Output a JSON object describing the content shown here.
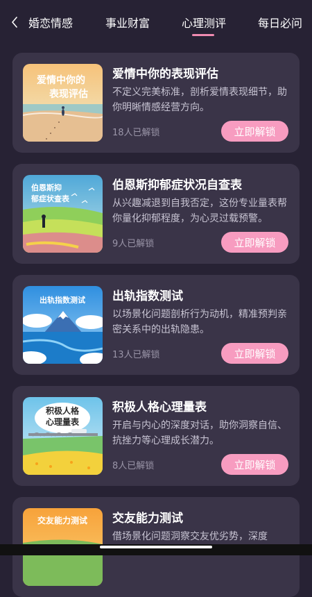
{
  "nav": {
    "back_icon": "chevron-left-icon",
    "tabs": [
      {
        "label": "婚恋情感",
        "active": false
      },
      {
        "label": "事业财富",
        "active": false
      },
      {
        "label": "心理测评",
        "active": true
      },
      {
        "label": "每日必问",
        "active": false
      }
    ]
  },
  "colors": {
    "background": "#272234",
    "card": "#3a3448",
    "accent": "#f79cc0",
    "tab_underline": "#f08bb1"
  },
  "cards": [
    {
      "title": "爱情中你的表现评估",
      "description": "不定义完美标准，剖析爱情表现细节，助你明晰情感经营方向。",
      "count": "18人已解锁",
      "button": "立即解锁",
      "thumb_text": [
        "爱情中你的",
        "表现评估"
      ]
    },
    {
      "title": "伯恩斯抑郁症状况自查表",
      "description": "从兴趣减退到自我否定，这份专业量表帮你量化抑郁程度，为心灵过载预警。",
      "count": "9人已解锁",
      "button": "立即解锁",
      "thumb_text": [
        "伯恩斯抑",
        "郁症状查表"
      ]
    },
    {
      "title": "出轨指数测试",
      "description": "以场景化问题剖析行为动机，精准预判亲密关系中的出轨隐患。",
      "count": "13人已解锁",
      "button": "立即解锁",
      "thumb_text": [
        "出轨指数测试"
      ]
    },
    {
      "title": "积极人格心理量表",
      "description": "开启与内心的深度对话，助你洞察自信、抗挫力等心理成长潜力。",
      "count": "8人已解锁",
      "button": "立即解锁",
      "thumb_text": [
        "积极人格",
        "心理量表"
      ]
    },
    {
      "title": "交友能力测试",
      "description": "借场景化问题洞察交友优劣势，深度",
      "count": "",
      "button": "",
      "thumb_text": [
        "交友能力测试"
      ]
    }
  ]
}
